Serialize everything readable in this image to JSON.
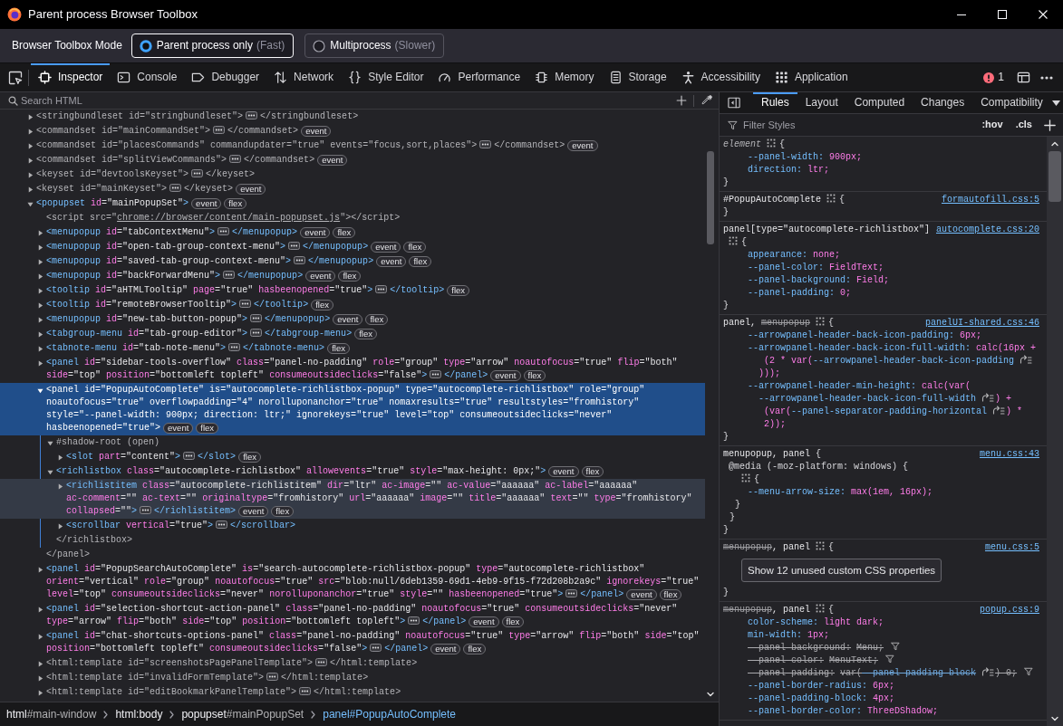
{
  "window": {
    "title": "Parent process Browser Toolbox"
  },
  "mode_bar": {
    "label": "Browser Toolbox Mode",
    "options": [
      {
        "label": "Parent process only",
        "hint": "(Fast)",
        "selected": true
      },
      {
        "label": "Multiprocess",
        "hint": "(Slower)",
        "selected": false
      }
    ]
  },
  "toolbox_tabs": [
    {
      "label": "Inspector",
      "selected": true
    },
    {
      "label": "Console",
      "selected": false
    },
    {
      "label": "Debugger",
      "selected": false
    },
    {
      "label": "Network",
      "selected": false
    },
    {
      "label": "Style Editor",
      "selected": false
    },
    {
      "label": "Performance",
      "selected": false
    },
    {
      "label": "Memory",
      "selected": false
    },
    {
      "label": "Storage",
      "selected": false
    },
    {
      "label": "Accessibility",
      "selected": false
    },
    {
      "label": "Application",
      "selected": false
    }
  ],
  "error_count": "1",
  "inspector": {
    "search": {
      "placeholder": "Search HTML"
    },
    "nodes": [
      {
        "kind": "element",
        "open": "<stringbundleset id=\"stringbundleset\">",
        "close": "</stringbundleset>",
        "expanded": false,
        "displayed": false,
        "selected": false,
        "hovered": false
      },
      {
        "kind": "element",
        "open": "<commandset id=\"mainCommandSet\">",
        "close": "</commandset>",
        "expanded": false,
        "displayed": false,
        "selected": false,
        "hovered": false,
        "badges": [
          "event"
        ]
      },
      {
        "kind": "element",
        "open": "<commandset id=\"placesCommands\" commandupdater=\"true\" events=\"focus,sort,places\">",
        "close": "</commandset>",
        "expanded": false,
        "displayed": false,
        "selected": false,
        "hovered": false,
        "badges": [
          "event"
        ]
      },
      {
        "kind": "element",
        "open": "<commandset id=\"splitViewCommands\">",
        "close": "</commandset>",
        "expanded": false,
        "displayed": false,
        "selected": false,
        "hovered": false,
        "badges": [
          "event"
        ]
      },
      {
        "kind": "element",
        "open": "<keyset id=\"devtoolsKeyset\">",
        "close": "</keyset>",
        "expanded": false,
        "displayed": false,
        "selected": false,
        "hovered": false
      },
      {
        "kind": "element",
        "open": "<keyset id=\"mainKeyset\">",
        "close": "</keyset>",
        "expanded": false,
        "displayed": false,
        "selected": false,
        "hovered": false,
        "badges": [
          "event"
        ]
      },
      {
        "kind": "element",
        "open": "<popupset id=\"mainPopupSet\">",
        "expanded": true,
        "displayed": true,
        "selected": false,
        "hovered": false,
        "badges": [
          "event",
          "flex"
        ],
        "children": [
          {
            "kind": "leaf",
            "open": "<script src=\"chrome://browser/content/main-popupset.js\">",
            "close": "</script>",
            "displayed": false,
            "selected": false,
            "hovered": false
          },
          {
            "kind": "element",
            "open": "<menupopup id=\"tabContextMenu\">",
            "close": "</menupopup>",
            "expanded": false,
            "displayed": true,
            "selected": false,
            "hovered": false,
            "badges": [
              "event",
              "flex"
            ]
          },
          {
            "kind": "element",
            "open": "<menupopup id=\"open-tab-group-context-menu\">",
            "close": "</menupopup>",
            "expanded": false,
            "displayed": true,
            "selected": false,
            "hovered": false,
            "badges": [
              "event",
              "flex"
            ]
          },
          {
            "kind": "element",
            "open": "<menupopup id=\"saved-tab-group-context-menu\">",
            "close": "</menupopup>",
            "expanded": false,
            "displayed": true,
            "selected": false,
            "hovered": false,
            "badges": [
              "event",
              "flex"
            ]
          },
          {
            "kind": "element",
            "open": "<menupopup id=\"backForwardMenu\">",
            "close": "</menupopup>",
            "expanded": false,
            "displayed": true,
            "selected": false,
            "hovered": false,
            "badges": [
              "event",
              "flex"
            ]
          },
          {
            "kind": "element",
            "open": "<tooltip id=\"aHTMLTooltip\" page=\"true\" hasbeenopened=\"true\">",
            "close": "</tooltip>",
            "expanded": false,
            "displayed": true,
            "selected": false,
            "hovered": false,
            "badges": [
              "flex"
            ]
          },
          {
            "kind": "element",
            "open": "<tooltip id=\"remoteBrowserTooltip\">",
            "close": "</tooltip>",
            "expanded": false,
            "displayed": true,
            "selected": false,
            "hovered": false,
            "badges": [
              "flex"
            ]
          },
          {
            "kind": "element",
            "open": "<menupopup id=\"new-tab-button-popup\">",
            "close": "</menupopup>",
            "expanded": false,
            "displayed": true,
            "selected": false,
            "hovered": false,
            "badges": [
              "event",
              "flex"
            ]
          },
          {
            "kind": "element",
            "open": "<tabgroup-menu id=\"tab-group-editor\">",
            "close": "</tabgroup-menu>",
            "expanded": false,
            "displayed": true,
            "selected": false,
            "hovered": false,
            "badges": [
              "flex"
            ]
          },
          {
            "kind": "element",
            "open": "<tabnote-menu id=\"tab-note-menu\">",
            "close": "</tabnote-menu>",
            "expanded": false,
            "displayed": true,
            "selected": false,
            "hovered": false,
            "badges": [
              "flex"
            ]
          },
          {
            "kind": "element",
            "open": "<panel id=\"sidebar-tools-overflow\" class=\"panel-no-padding\" role=\"group\" type=\"arrow\" noautofocus=\"true\" flip=\"both\" side=\"top\" position=\"bottomleft topleft\" consumeoutsideclicks=\"false\">",
            "close": "</panel>",
            "expanded": false,
            "displayed": true,
            "selected": false,
            "hovered": false,
            "badges": [
              "event",
              "flex"
            ]
          },
          {
            "kind": "element",
            "open": "<panel id=\"PopupAutoComplete\" is=\"autocomplete-richlistbox-popup\" type=\"autocomplete-richlistbox\" role=\"group\" noautofocus=\"true\" overflowpadding=\"4\" norolluponanchor=\"true\" nomaxresults=\"true\" resultstyles=\"fromhistory\" style=\"--panel-width: 900px; direction: ltr;\" ignorekeys=\"true\" level=\"top\" consumeoutsideclicks=\"never\" hasbeenopened=\"true\">",
            "close": "</panel>",
            "expanded": true,
            "displayed": true,
            "selected": true,
            "hovered": false,
            "badges": [
              "event",
              "flex"
            ],
            "children": [
              {
                "kind": "shadow_root",
                "label": "#shadow-root (open)",
                "expanded": true,
                "selected": false,
                "hovered": false,
                "children": [
                  {
                    "kind": "element",
                    "open": "<slot part=\"content\">",
                    "close": "</slot>",
                    "expanded": false,
                    "displayed": true,
                    "selected": false,
                    "hovered": false,
                    "badges": [
                      "flex"
                    ]
                  }
                ]
              },
              {
                "kind": "element",
                "open": "<richlistbox class=\"autocomplete-richlistbox\" allowevents=\"true\" style=\"max-height: 0px;\">",
                "close": "</richlistbox>",
                "expanded": true,
                "displayed": true,
                "selected": false,
                "hovered": false,
                "badges": [
                  "event",
                  "flex"
                ],
                "children": [
                  {
                    "kind": "element",
                    "open": "<richlistitem class=\"autocomplete-richlistitem\" dir=\"ltr\" ac-image=\"\" ac-value=\"aaaaaa\" ac-label=\"aaaaaa\" ac-comment=\"\" ac-text=\"\" originaltype=\"fromhistory\" url=\"aaaaaa\" image=\"\" title=\"aaaaaa\" text=\"\" type=\"fromhistory\" collapsed=\"\">",
                    "close": "</richlistitem>",
                    "expanded": false,
                    "displayed": true,
                    "selected": false,
                    "hovered": true,
                    "badges": [
                      "event",
                      "flex"
                    ]
                  },
                  {
                    "kind": "element",
                    "open": "<scrollbar vertical=\"true\">",
                    "close": "</scrollbar>",
                    "expanded": false,
                    "displayed": true,
                    "selected": false,
                    "hovered": false
                  }
                ]
              }
            ]
          },
          {
            "kind": "element",
            "open": "<panel id=\"PopupSearchAutoComplete\" is=\"search-autocomplete-richlistbox-popup\" type=\"autocomplete-richlistbox\" orient=\"vertical\" role=\"group\" noautofocus=\"true\" src=\"blob:null/6deb1359-69d1-4eb9-9f15-f72d208b2a9c\" ignorekeys=\"true\" level=\"top\" consumeoutsideclicks=\"never\" norolluponanchor=\"true\" style=\"\" hasbeenopened=\"true\">",
            "close": "</panel>",
            "expanded": false,
            "displayed": true,
            "selected": false,
            "hovered": false,
            "badges": [
              "event",
              "flex"
            ]
          },
          {
            "kind": "element",
            "open": "<panel id=\"selection-shortcut-action-panel\" class=\"panel-no-padding\" noautofocus=\"true\" consumeoutsideclicks=\"never\" type=\"arrow\" flip=\"both\" side=\"top\" position=\"bottomleft topleft\">",
            "close": "</panel>",
            "expanded": false,
            "displayed": true,
            "selected": false,
            "hovered": false,
            "badges": [
              "event",
              "flex"
            ]
          },
          {
            "kind": "element",
            "open": "<panel id=\"chat-shortcuts-options-panel\" class=\"panel-no-padding\" noautofocus=\"true\" type=\"arrow\" flip=\"both\" side=\"top\" position=\"bottomleft topleft\" consumeoutsideclicks=\"false\">",
            "close": "</panel>",
            "expanded": false,
            "displayed": true,
            "selected": false,
            "hovered": false,
            "badges": [
              "event",
              "flex"
            ]
          },
          {
            "kind": "element",
            "open": "<html:template id=\"screenshotsPagePanelTemplate\">",
            "close": "</html:template>",
            "expanded": false,
            "displayed": false,
            "selected": false,
            "hovered": false
          },
          {
            "kind": "element",
            "open": "<html:template id=\"invalidFormTemplate\">",
            "close": "</html:template>",
            "expanded": false,
            "displayed": false,
            "selected": false,
            "hovered": false
          },
          {
            "kind": "element",
            "open": "<html:template id=\"editBookmarkPanelTemplate\">",
            "close": "</html:template>",
            "expanded": false,
            "displayed": false,
            "selected": false,
            "hovered": false
          }
        ]
      }
    ],
    "breadcrumbs": [
      {
        "tag": "html",
        "id": "#main-window",
        "selected": false
      },
      {
        "tag": "html:body",
        "selected": false
      },
      {
        "tag": "popupset",
        "id": "#mainPopupSet",
        "selected": false
      },
      {
        "tag": "panel",
        "id": "#PopupAutoComplete",
        "selected": true
      }
    ]
  },
  "sidebar": {
    "tabs": [
      {
        "label": "Rules",
        "selected": true
      },
      {
        "label": "Layout",
        "selected": false
      },
      {
        "label": "Computed",
        "selected": false
      },
      {
        "label": "Changes",
        "selected": false
      },
      {
        "label": "Compatibility",
        "selected": false
      }
    ],
    "filter": {
      "placeholder": "Filter Styles"
    },
    "toggles": [
      ":hov",
      ".cls"
    ],
    "rules": [
      {
        "kind": "element",
        "selector": [
          {
            "text": "element",
            "matched": true
          }
        ],
        "open": "{",
        "declarations": [
          {
            "name": "--panel-width:",
            "value": [
              "900px;"
            ],
            "overridden": false
          },
          {
            "name": "direction:",
            "value": [
              "ltr;"
            ],
            "overridden": false
          }
        ],
        "close": "}"
      },
      {
        "kind": "rule",
        "selector": [
          {
            "text": "#PopupAutoComplete",
            "matched": true
          }
        ],
        "source": "formautofill.css:5",
        "open": "{",
        "close": "}"
      },
      {
        "kind": "rule",
        "selector": [
          {
            "text": "panel[type=\"autocomplete-richlistbox\"]",
            "matched": true
          }
        ],
        "source": "autocomplete.css:20",
        "open": "{",
        "declarations": [
          {
            "name": "appearance:",
            "value": [
              "none;"
            ],
            "overridden": false
          },
          {
            "name": "--panel-color:",
            "value": [
              "FieldText;"
            ],
            "overridden": false
          },
          {
            "name": "--panel-background:",
            "value": [
              "Field;"
            ],
            "overridden": false
          },
          {
            "name": "--panel-padding:",
            "value": [
              "0;"
            ],
            "overridden": false
          }
        ],
        "close": "}"
      },
      {
        "kind": "rule",
        "selector": [
          {
            "text": "panel, ",
            "matched": true
          },
          {
            "text": "menupopup",
            "matched": false
          }
        ],
        "source": "panelUI-shared.css:46",
        "open": "{",
        "declarations": [
          {
            "name": "--arrowpanel-header-back-icon-padding:",
            "value": [
              "6px;"
            ],
            "overridden": false
          },
          {
            "name": "--arrowpanel-header-back-icon-full-width:",
            "value": [
              "calc(16px +",
              "(2 * var(",
              {
                "variable": "--arrowpanel-header-back-icon-padding"
              },
              ")));"
            ],
            "overridden": false
          },
          {
            "name": "--arrowpanel-header-min-height:",
            "value": [
              "calc(var(",
              {
                "variable": "--arrowpanel-header-back-icon-full-width"
              },
              ") +",
              "(var(",
              {
                "variable": "--panel-separator-padding-horizontal"
              },
              ") *",
              "2));"
            ],
            "overridden": false
          }
        ],
        "close": "}"
      },
      {
        "kind": "rule",
        "selector": [
          {
            "text": "menupopup, panel",
            "matched": true
          }
        ],
        "source": "menu.css:43",
        "open": "{",
        "nested": {
          "at_rule": "@media (-moz-platform: windows) {",
          "open": "{",
          "declarations": [
            {
              "name": "--menu-arrow-size:",
              "value": [
                "max(1em, 16px);"
              ],
              "overridden": false
            }
          ],
          "close": "}",
          "at_close": "}"
        },
        "close": "}"
      },
      {
        "kind": "rule",
        "selector": [
          {
            "text": "menupopup",
            "matched": false
          },
          {
            "text": ", panel",
            "matched": true
          }
        ],
        "source": "menu.css:5",
        "open": "{",
        "unused_button": "Show 12 unused custom CSS properties",
        "close": "}"
      },
      {
        "kind": "rule",
        "selector": [
          {
            "text": "menupopup",
            "matched": false
          },
          {
            "text": ", panel",
            "matched": true
          }
        ],
        "source": "popup.css:9",
        "open": "{",
        "declarations": [
          {
            "name": "color-scheme:",
            "value": [
              "light dark;"
            ],
            "overridden": false
          },
          {
            "name": "min-width:",
            "value": [
              "1px;"
            ],
            "overridden": false
          },
          {
            "name": "--panel-background:",
            "value": [
              "Menu;"
            ],
            "overridden": true
          },
          {
            "name": "--panel-color:",
            "value": [
              "MenuText;"
            ],
            "overridden": true
          },
          {
            "name": "--panel-padding:",
            "value": [
              "var(",
              {
                "variable": "--panel-padding-block"
              },
              ") 0;"
            ],
            "overridden": true
          },
          {
            "name": "--panel-border-radius:",
            "value": [
              "6px;"
            ],
            "overridden": false
          },
          {
            "name": "--panel-padding-block:",
            "value": [
              "4px;"
            ],
            "overridden": false
          },
          {
            "name": "--panel-border-color:",
            "value": [
              "ThreeDShadow;"
            ],
            "overridden": false
          }
        ]
      }
    ]
  }
}
